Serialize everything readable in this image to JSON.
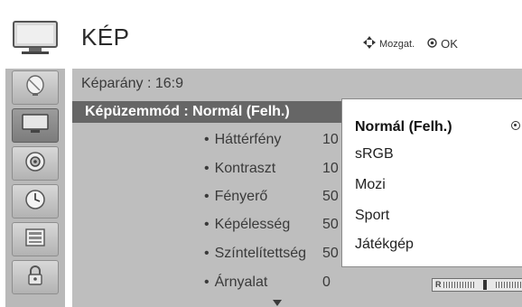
{
  "header": {
    "title": "KÉP",
    "hint_move": "Mozgat.",
    "hint_ok": "OK"
  },
  "sidebar": {
    "items": [
      {
        "name": "setup",
        "icon": "satellite-dish-icon",
        "active": false
      },
      {
        "name": "picture",
        "icon": "tv-icon",
        "active": true
      },
      {
        "name": "audio",
        "icon": "speaker-icon",
        "active": false
      },
      {
        "name": "time",
        "icon": "clock-icon",
        "active": false
      },
      {
        "name": "option",
        "icon": "option-icon",
        "active": false
      },
      {
        "name": "lock",
        "icon": "lock-icon",
        "active": false
      }
    ]
  },
  "menu": {
    "aspect_label": "Képarány",
    "aspect_value": ": 16:9",
    "mode_label": "Képüzemmód",
    "mode_value": ": Normál (Felh.)",
    "settings": [
      {
        "label": "Háttérfény",
        "value": "10"
      },
      {
        "label": "Kontraszt",
        "value": "10"
      },
      {
        "label": "Fényerő",
        "value": "50"
      },
      {
        "label": "Képélesség",
        "value": "50"
      },
      {
        "label": "Színtelítettség",
        "value": "50"
      },
      {
        "label": "Árnyalat",
        "value": "0"
      }
    ],
    "tint_bar": {
      "left_label": "R",
      "right_label": "G",
      "level": 0.5
    }
  },
  "dropdown": {
    "options": [
      "Normál (Felh.)",
      "sRGB",
      "Mozi",
      "Sport",
      "Játékgép"
    ],
    "selected": "Normál (Felh.)"
  }
}
